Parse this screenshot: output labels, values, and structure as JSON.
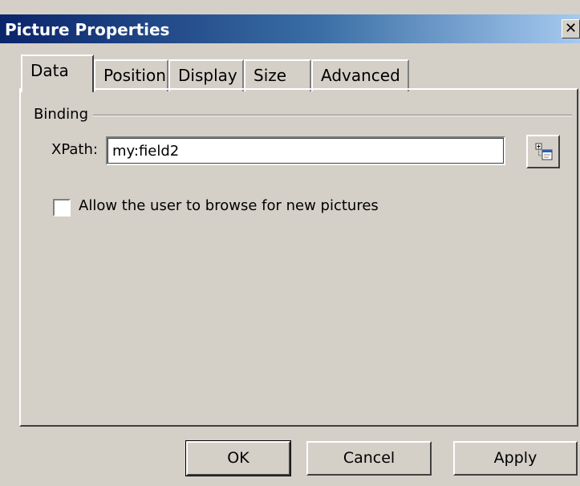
{
  "window": {
    "title": "Picture Properties",
    "close_glyph": "✕"
  },
  "tabs": [
    {
      "label": "Data",
      "active": true
    },
    {
      "label": "Position",
      "active": false
    },
    {
      "label": "Display",
      "active": false
    },
    {
      "label": "Size",
      "active": false
    },
    {
      "label": "Advanced",
      "active": false
    }
  ],
  "binding": {
    "group_label": "Binding",
    "xpath_label": "XPath:",
    "xpath_value": "my:field2",
    "picker_icon": "select-xpath-icon",
    "checkbox_label": "Allow the user to browse for new pictures",
    "checkbox_checked": false
  },
  "buttons": {
    "ok": "OK",
    "cancel": "Cancel",
    "apply": "Apply"
  },
  "colors": {
    "face": "#d4d0c8",
    "title_start": "#0a246a",
    "title_end": "#a6caf0"
  }
}
